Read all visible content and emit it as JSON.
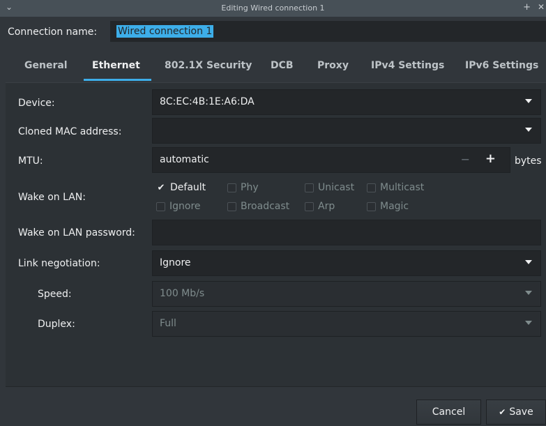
{
  "window": {
    "title": "Editing Wired connection 1"
  },
  "connection": {
    "label": "Connection name:",
    "value": "Wired connection 1"
  },
  "tabs": [
    {
      "label": "General"
    },
    {
      "label": "Ethernet"
    },
    {
      "label": "802.1X Security"
    },
    {
      "label": "DCB"
    },
    {
      "label": "Proxy"
    },
    {
      "label": "IPv4 Settings"
    },
    {
      "label": "IPv6 Settings"
    }
  ],
  "form": {
    "device": {
      "label": "Device:",
      "value": "8C:EC:4B:1E:A6:DA"
    },
    "cloned_mac": {
      "label": "Cloned MAC address:",
      "value": ""
    },
    "mtu": {
      "label": "MTU:",
      "value": "automatic",
      "unit": "bytes"
    },
    "wol": {
      "label": "Wake on LAN:",
      "options": [
        {
          "label": "Default",
          "checked": true
        },
        {
          "label": "Phy",
          "checked": false
        },
        {
          "label": "Unicast",
          "checked": false
        },
        {
          "label": "Multicast",
          "checked": false
        },
        {
          "label": "Ignore",
          "checked": false
        },
        {
          "label": "Broadcast",
          "checked": false
        },
        {
          "label": "Arp",
          "checked": false
        },
        {
          "label": "Magic",
          "checked": false
        }
      ]
    },
    "wol_password": {
      "label": "Wake on LAN password:",
      "value": ""
    },
    "link_negotiation": {
      "label": "Link negotiation:",
      "value": "Ignore"
    },
    "speed": {
      "label": "Speed:",
      "value": "100 Mb/s"
    },
    "duplex": {
      "label": "Duplex:",
      "value": "Full"
    }
  },
  "footer": {
    "cancel": "Cancel",
    "save": "Save"
  },
  "icons": {
    "menu": "chevron-down-icon",
    "keep_above": "plus-icon",
    "close": "close-icon",
    "check": "check-icon"
  }
}
